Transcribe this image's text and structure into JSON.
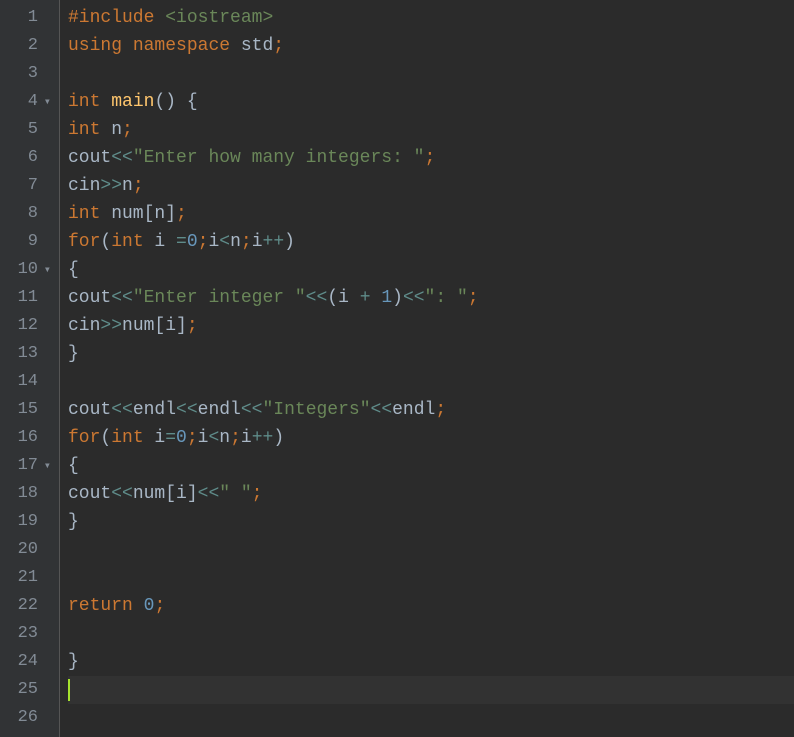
{
  "editor": {
    "lines": [
      {
        "num": "1",
        "fold": "",
        "tokens": [
          {
            "cls": "tok-hash",
            "t": "#include"
          },
          {
            "cls": "tok-plain",
            "t": " "
          },
          {
            "cls": "tok-angle",
            "t": "<iostream>"
          }
        ]
      },
      {
        "num": "2",
        "fold": "",
        "tokens": [
          {
            "cls": "tok-keyword",
            "t": "using"
          },
          {
            "cls": "tok-plain",
            "t": " "
          },
          {
            "cls": "tok-keyword",
            "t": "namespace"
          },
          {
            "cls": "tok-plain",
            "t": " std"
          },
          {
            "cls": "tok-semicolon",
            "t": ";"
          }
        ]
      },
      {
        "num": "3",
        "fold": "",
        "tokens": []
      },
      {
        "num": "4",
        "fold": "▾",
        "tokens": [
          {
            "cls": "tok-keyword",
            "t": "int"
          },
          {
            "cls": "tok-plain",
            "t": " "
          },
          {
            "cls": "tok-func",
            "t": "main"
          },
          {
            "cls": "tok-paren",
            "t": "()"
          },
          {
            "cls": "tok-plain",
            "t": " "
          },
          {
            "cls": "tok-brace",
            "t": "{"
          }
        ]
      },
      {
        "num": "5",
        "fold": "",
        "tokens": [
          {
            "cls": "tok-keyword",
            "t": "int"
          },
          {
            "cls": "tok-plain",
            "t": " n"
          },
          {
            "cls": "tok-semicolon",
            "t": ";"
          }
        ]
      },
      {
        "num": "6",
        "fold": "",
        "tokens": [
          {
            "cls": "tok-plain",
            "t": "cout"
          },
          {
            "cls": "tok-lt",
            "t": "<<"
          },
          {
            "cls": "tok-string",
            "t": "\"Enter how many integers: \""
          },
          {
            "cls": "tok-semicolon",
            "t": ";"
          }
        ]
      },
      {
        "num": "7",
        "fold": "",
        "tokens": [
          {
            "cls": "tok-plain",
            "t": "cin"
          },
          {
            "cls": "tok-lt",
            "t": ">>"
          },
          {
            "cls": "tok-plain",
            "t": "n"
          },
          {
            "cls": "tok-semicolon",
            "t": ";"
          }
        ]
      },
      {
        "num": "8",
        "fold": "",
        "tokens": [
          {
            "cls": "tok-keyword",
            "t": "int"
          },
          {
            "cls": "tok-plain",
            "t": " num[n]"
          },
          {
            "cls": "tok-semicolon",
            "t": ";"
          }
        ]
      },
      {
        "num": "9",
        "fold": "",
        "tokens": [
          {
            "cls": "tok-keyword",
            "t": "for"
          },
          {
            "cls": "tok-paren",
            "t": "("
          },
          {
            "cls": "tok-keyword",
            "t": "int"
          },
          {
            "cls": "tok-plain",
            "t": " i "
          },
          {
            "cls": "tok-lt",
            "t": "="
          },
          {
            "cls": "tok-number",
            "t": "0"
          },
          {
            "cls": "tok-semicolon",
            "t": ";"
          },
          {
            "cls": "tok-plain",
            "t": "i"
          },
          {
            "cls": "tok-lt",
            "t": "<"
          },
          {
            "cls": "tok-plain",
            "t": "n"
          },
          {
            "cls": "tok-semicolon",
            "t": ";"
          },
          {
            "cls": "tok-plain",
            "t": "i"
          },
          {
            "cls": "tok-pp",
            "t": "++"
          },
          {
            "cls": "tok-paren",
            "t": ")"
          }
        ]
      },
      {
        "num": "10",
        "fold": "▾",
        "tokens": [
          {
            "cls": "tok-brace",
            "t": "{"
          }
        ]
      },
      {
        "num": "11",
        "fold": "",
        "tokens": [
          {
            "cls": "tok-plain",
            "t": "cout"
          },
          {
            "cls": "tok-lt",
            "t": "<<"
          },
          {
            "cls": "tok-string",
            "t": "\"Enter integer \""
          },
          {
            "cls": "tok-lt",
            "t": "<<"
          },
          {
            "cls": "tok-paren",
            "t": "("
          },
          {
            "cls": "tok-plain",
            "t": "i "
          },
          {
            "cls": "tok-lt",
            "t": "+"
          },
          {
            "cls": "tok-plain",
            "t": " "
          },
          {
            "cls": "tok-number",
            "t": "1"
          },
          {
            "cls": "tok-paren",
            "t": ")"
          },
          {
            "cls": "tok-lt",
            "t": "<<"
          },
          {
            "cls": "tok-string",
            "t": "\": \""
          },
          {
            "cls": "tok-semicolon",
            "t": ";"
          }
        ]
      },
      {
        "num": "12",
        "fold": "",
        "tokens": [
          {
            "cls": "tok-plain",
            "t": "cin"
          },
          {
            "cls": "tok-lt",
            "t": ">>"
          },
          {
            "cls": "tok-plain",
            "t": "num[i]"
          },
          {
            "cls": "tok-semicolon",
            "t": ";"
          }
        ]
      },
      {
        "num": "13",
        "fold": "",
        "tokens": [
          {
            "cls": "tok-brace",
            "t": "}"
          }
        ]
      },
      {
        "num": "14",
        "fold": "",
        "tokens": []
      },
      {
        "num": "15",
        "fold": "",
        "tokens": [
          {
            "cls": "tok-plain",
            "t": "cout"
          },
          {
            "cls": "tok-lt",
            "t": "<<"
          },
          {
            "cls": "tok-plain",
            "t": "endl"
          },
          {
            "cls": "tok-lt",
            "t": "<<"
          },
          {
            "cls": "tok-plain",
            "t": "endl"
          },
          {
            "cls": "tok-lt",
            "t": "<<"
          },
          {
            "cls": "tok-string",
            "t": "\"Integers\""
          },
          {
            "cls": "tok-lt",
            "t": "<<"
          },
          {
            "cls": "tok-plain",
            "t": "endl"
          },
          {
            "cls": "tok-semicolon",
            "t": ";"
          }
        ]
      },
      {
        "num": "16",
        "fold": "",
        "tokens": [
          {
            "cls": "tok-keyword",
            "t": "for"
          },
          {
            "cls": "tok-paren",
            "t": "("
          },
          {
            "cls": "tok-keyword",
            "t": "int"
          },
          {
            "cls": "tok-plain",
            "t": " i"
          },
          {
            "cls": "tok-lt",
            "t": "="
          },
          {
            "cls": "tok-number",
            "t": "0"
          },
          {
            "cls": "tok-semicolon",
            "t": ";"
          },
          {
            "cls": "tok-plain",
            "t": "i"
          },
          {
            "cls": "tok-lt",
            "t": "<"
          },
          {
            "cls": "tok-plain",
            "t": "n"
          },
          {
            "cls": "tok-semicolon",
            "t": ";"
          },
          {
            "cls": "tok-plain",
            "t": "i"
          },
          {
            "cls": "tok-pp",
            "t": "++"
          },
          {
            "cls": "tok-paren",
            "t": ")"
          }
        ]
      },
      {
        "num": "17",
        "fold": "▾",
        "tokens": [
          {
            "cls": "tok-brace",
            "t": "{"
          }
        ]
      },
      {
        "num": "18",
        "fold": "",
        "tokens": [
          {
            "cls": "tok-plain",
            "t": "cout"
          },
          {
            "cls": "tok-lt",
            "t": "<<"
          },
          {
            "cls": "tok-plain",
            "t": "num[i]"
          },
          {
            "cls": "tok-lt",
            "t": "<<"
          },
          {
            "cls": "tok-string",
            "t": "\" \""
          },
          {
            "cls": "tok-semicolon",
            "t": ";"
          }
        ]
      },
      {
        "num": "19",
        "fold": "",
        "tokens": [
          {
            "cls": "tok-brace",
            "t": "}"
          }
        ]
      },
      {
        "num": "20",
        "fold": "",
        "tokens": []
      },
      {
        "num": "21",
        "fold": "",
        "tokens": []
      },
      {
        "num": "22",
        "fold": "",
        "tokens": [
          {
            "cls": "tok-keyword",
            "t": "return"
          },
          {
            "cls": "tok-plain",
            "t": " "
          },
          {
            "cls": "tok-number",
            "t": "0"
          },
          {
            "cls": "tok-semicolon",
            "t": ";"
          }
        ]
      },
      {
        "num": "23",
        "fold": "",
        "tokens": []
      },
      {
        "num": "24",
        "fold": "",
        "tokens": [
          {
            "cls": "tok-brace",
            "t": "}"
          }
        ]
      },
      {
        "num": "25",
        "fold": "",
        "tokens": [],
        "active": true,
        "cursor": true
      },
      {
        "num": "26",
        "fold": "",
        "tokens": []
      }
    ]
  }
}
